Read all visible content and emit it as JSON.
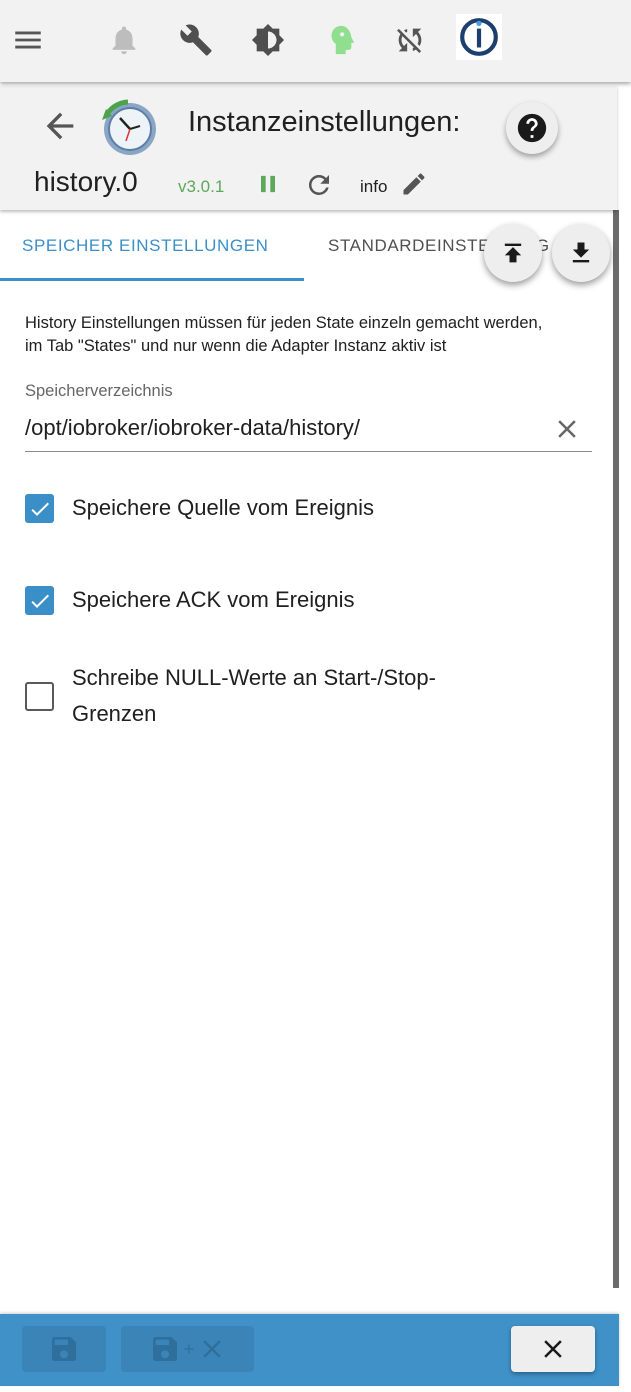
{
  "topbar": {
    "icons": [
      "menu-icon",
      "bell-icon",
      "wrench-icon",
      "brightness-icon",
      "expert-mode-icon",
      "sync-disabled-icon",
      "iobroker-logo"
    ],
    "expert_color": "#8fdf8f"
  },
  "header": {
    "title": "Instanzeinstellungen:",
    "instance": "history.0",
    "version": "v3.0.1",
    "info_label": "info",
    "version_color": "#5da85a"
  },
  "tabs": {
    "active": "SPEICHER EINSTELLUNGEN",
    "inactive": "STANDARDEINSTELLUNG"
  },
  "content": {
    "description_line1": "History Einstellungen müssen für jeden State einzeln gemacht werden,",
    "description_line2": "im Tab \"States\" und nur wenn die Adapter Instanz aktiv ist",
    "storage_dir_label": "Speicherverzeichnis",
    "storage_dir_value": "/opt/iobroker/iobroker-data/history/",
    "checkboxes": [
      {
        "label": "Speichere Quelle vom Ereignis",
        "checked": true
      },
      {
        "label": "Speichere ACK vom Ereignis",
        "checked": true
      },
      {
        "label_line1": "Schreibe NULL-Werte an Start-/Stop-",
        "label_line2": "Grenzen",
        "checked": false
      }
    ]
  },
  "colors": {
    "accent": "#3a8fc8",
    "bottom_bar": "#3f91c8"
  }
}
